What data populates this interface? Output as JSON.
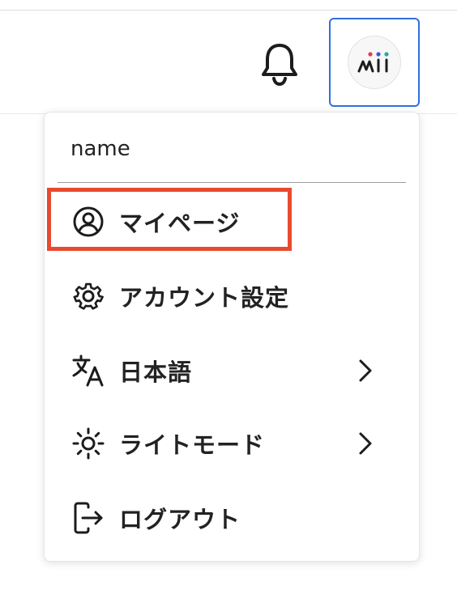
{
  "header": {
    "notifications": {
      "icon": "bell-icon"
    },
    "user_avatar": {
      "icon": "mi-logo-icon"
    }
  },
  "menu": {
    "user_name": "name",
    "items": [
      {
        "label": "マイページ",
        "icon": "user-circle-icon",
        "has_submenu": false,
        "highlighted": true
      },
      {
        "label": "アカウント設定",
        "icon": "gear-icon",
        "has_submenu": false,
        "highlighted": false
      },
      {
        "label": "日本語",
        "icon": "translate-icon",
        "has_submenu": true,
        "highlighted": false
      },
      {
        "label": "ライトモード",
        "icon": "sun-icon",
        "has_submenu": true,
        "highlighted": false
      },
      {
        "label": "ログアウト",
        "icon": "logout-icon",
        "has_submenu": false,
        "highlighted": false
      }
    ]
  },
  "colors": {
    "focus_border": "#2f6fdc",
    "highlight_border": "#e84a2f",
    "logo_dot_red": "#e03c52",
    "logo_dot_blue": "#3a5bd6",
    "logo_dot_teal": "#2aa6a0"
  }
}
